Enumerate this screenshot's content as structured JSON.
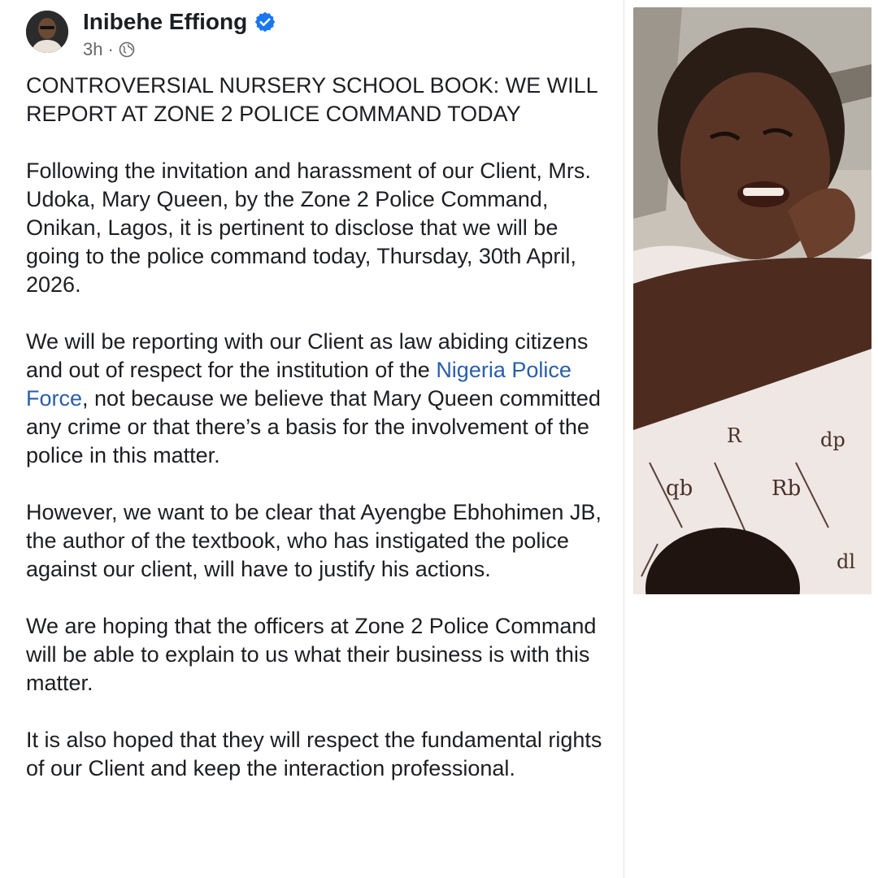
{
  "post": {
    "author_name": "Inibehe Effiong",
    "verified_icon": "verified-badge-icon",
    "time_ago": "3h",
    "separator": "·",
    "audience_icon": "globe-icon",
    "title": "CONTROVERSIAL NURSERY SCHOOL BOOK: WE WILL REPORT AT ZONE 2 POLICE COMMAND TODAY",
    "paragraph_1": "Following the invitation and harassment of our Client, Mrs. Udoka, Mary Queen, by the Zone 2 Police Command, Onikan, Lagos, it is pertinent to disclose that we will be going to the police command today, Thursday, 30th April, 2026.",
    "paragraph_2_before_link": "We will be reporting with our Client as law abiding citizens and out of respect for the institution of the ",
    "paragraph_2_link": "Nigeria Police Force",
    "paragraph_2_after_link": ", not because we believe that Mary Queen committed any crime or that there’s a basis for the involvement of the police in this matter.",
    "paragraph_3": "However, we want to be clear that Ayengbe Ebhohimen JB, the author of the textbook, who has instigated the police against our client, will have to justify his actions.",
    "paragraph_4": "We are hoping that the officers at Zone 2 Police Command will be able to explain to us what their business is with this matter.",
    "paragraph_5": "It is also hoped that they will respect the fundamental rights of our Client and keep the interaction professional."
  },
  "colors": {
    "link": "#2a5ea8",
    "verified": "#1877f2",
    "meta_text": "#65676b"
  }
}
